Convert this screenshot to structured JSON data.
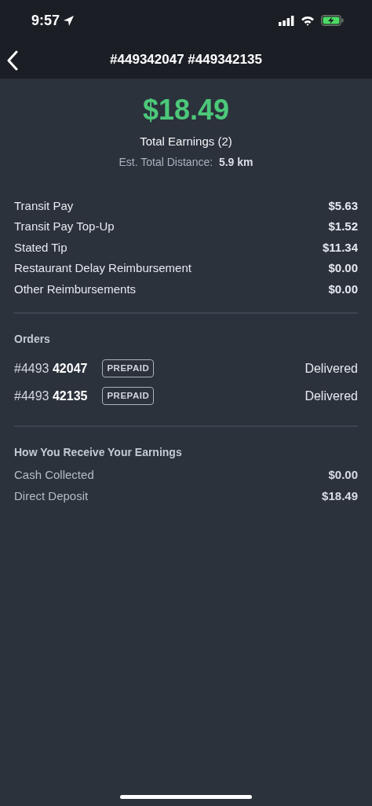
{
  "status_bar": {
    "time": "9:57"
  },
  "header": {
    "title": "#449342047 #449342135"
  },
  "summary": {
    "amount": "$18.49",
    "label": "Total Earnings (2)",
    "distance_label": "Est. Total Distance:",
    "distance_value": "5.9 km"
  },
  "earnings": [
    {
      "label": "Transit Pay",
      "value": "$5.63"
    },
    {
      "label": "Transit Pay Top-Up",
      "value": "$1.52"
    },
    {
      "label": "Stated Tip",
      "value": "$11.34"
    },
    {
      "label": "Restaurant Delay Reimbursement",
      "value": "$0.00"
    },
    {
      "label": "Other Reimbursements",
      "value": "$0.00"
    }
  ],
  "orders": {
    "title": "Orders",
    "items": [
      {
        "number": "#4493 **42047**",
        "tag": "PREPAID",
        "status": "Delivered"
      },
      {
        "number": "#4493 **42135**",
        "tag": "PREPAID",
        "status": "Delivered"
      }
    ]
  },
  "receive": {
    "title": "How You Receive Your Earnings",
    "rows": [
      {
        "label": "Cash Collected",
        "value": "$0.00"
      },
      {
        "label": "Direct Deposit",
        "value": "$18.49"
      }
    ]
  }
}
